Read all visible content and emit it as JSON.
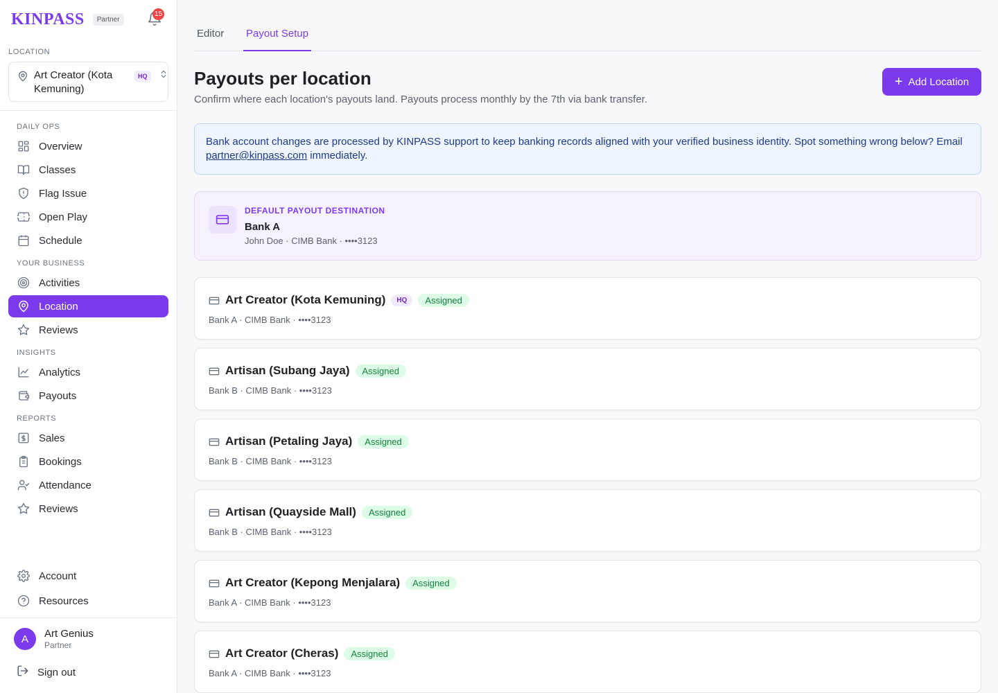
{
  "brand": {
    "name": "KINPASS",
    "chip": "Partner",
    "notifications": "15"
  },
  "location_selector": {
    "label": "LOCATION",
    "value": "Art Creator (Kota Kemuning)",
    "badge": "HQ"
  },
  "nav": {
    "groups": [
      {
        "label": "DAILY OPS",
        "items": [
          {
            "label": "Overview",
            "icon": "grid-icon"
          },
          {
            "label": "Classes",
            "icon": "book-icon"
          },
          {
            "label": "Flag Issue",
            "icon": "shield-alert-icon"
          },
          {
            "label": "Open Play",
            "icon": "ticket-icon"
          },
          {
            "label": "Schedule",
            "icon": "calendar-icon"
          }
        ]
      },
      {
        "label": "YOUR BUSINESS",
        "items": [
          {
            "label": "Activities",
            "icon": "target-icon"
          },
          {
            "label": "Location",
            "icon": "map-pin-icon",
            "active": true
          },
          {
            "label": "Reviews",
            "icon": "star-icon"
          }
        ]
      },
      {
        "label": "INSIGHTS",
        "items": [
          {
            "label": "Analytics",
            "icon": "line-chart-icon"
          },
          {
            "label": "Payouts",
            "icon": "wallet-icon"
          }
        ]
      },
      {
        "label": "REPORTS",
        "items": [
          {
            "label": "Sales",
            "icon": "dollar-icon"
          },
          {
            "label": "Bookings",
            "icon": "clipboard-icon"
          },
          {
            "label": "Attendance",
            "icon": "user-check-icon"
          },
          {
            "label": "Reviews",
            "icon": "star-icon"
          }
        ]
      }
    ],
    "footer": [
      {
        "label": "Account",
        "icon": "gear-icon"
      },
      {
        "label": "Resources",
        "icon": "help-circle-icon"
      }
    ]
  },
  "user": {
    "initial": "A",
    "name": "Art Genius",
    "role": "Partner",
    "signout": "Sign out"
  },
  "tabs": [
    {
      "label": "Editor"
    },
    {
      "label": "Payout Setup",
      "active": true
    }
  ],
  "header": {
    "title": "Payouts per location",
    "subtitle": "Confirm where each location's payouts land. Payouts process monthly by the 7th via bank transfer.",
    "add_button": "Add Location"
  },
  "notice": {
    "text_before": "Bank account changes are processed by KINPASS support to keep banking records aligned with your verified business identity. Spot something wrong below? Email ",
    "email": "partner@kinpass.com",
    "text_after": " immediately."
  },
  "default_payout": {
    "label": "DEFAULT PAYOUT DESTINATION",
    "bank": "Bank A",
    "meta": "John Doe · CIMB Bank · ••••3123"
  },
  "locations": [
    {
      "name": "Art Creator (Kota Kemuning)",
      "hq": "HQ",
      "status": "Assigned",
      "meta": "Bank A · CIMB Bank · ••••3123"
    },
    {
      "name": "Artisan (Subang Jaya)",
      "status": "Assigned",
      "meta": "Bank B · CIMB Bank · ••••3123"
    },
    {
      "name": "Artisan (Petaling Jaya)",
      "status": "Assigned",
      "meta": "Bank B · CIMB Bank · ••••3123"
    },
    {
      "name": "Artisan (Quayside Mall)",
      "status": "Assigned",
      "meta": "Bank B · CIMB Bank · ••••3123"
    },
    {
      "name": "Art Creator (Kepong Menjalara)",
      "status": "Assigned",
      "meta": "Bank A · CIMB Bank · ••••3123"
    },
    {
      "name": "Art Creator (Cheras)",
      "status": "Assigned",
      "meta": "Bank A · CIMB Bank · ••••3123"
    }
  ],
  "colors": {
    "accent": "#7c3aed",
    "success": "#15803d",
    "info_bg": "#eef5ff",
    "badge_red": "#ef4444"
  }
}
